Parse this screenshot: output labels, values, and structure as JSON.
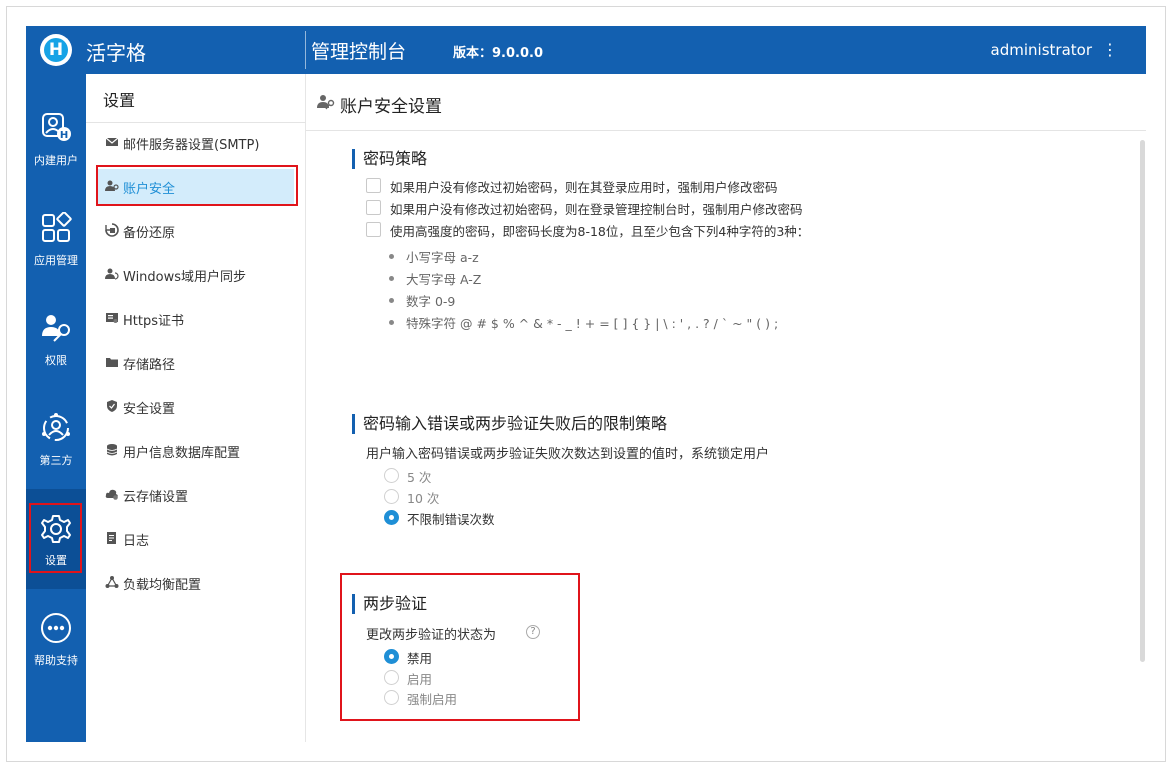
{
  "app": {
    "brand": "活字格",
    "console_title": "管理控制台",
    "version": "版本：9.0.0.0",
    "user": "administrator"
  },
  "rail": [
    {
      "label": "内建用户",
      "icon": "user-badge-icon"
    },
    {
      "label": "应用管理",
      "icon": "apps-grid-icon"
    },
    {
      "label": "权限",
      "icon": "user-key-icon"
    },
    {
      "label": "第三方",
      "icon": "third-party-icon"
    },
    {
      "label": "设置",
      "icon": "gear-icon"
    },
    {
      "label": "帮助支持",
      "icon": "more-dots-icon"
    }
  ],
  "nav": {
    "title": "设置",
    "items": [
      {
        "label": "邮件服务器设置(SMTP)",
        "icon": "mail-icon"
      },
      {
        "label": "账户安全",
        "icon": "user-key-icon"
      },
      {
        "label": "备份还原",
        "icon": "backup-icon"
      },
      {
        "label": "Windows域用户同步",
        "icon": "sync-users-icon"
      },
      {
        "label": "Https证书",
        "icon": "certificate-icon"
      },
      {
        "label": "存储路径",
        "icon": "folder-icon"
      },
      {
        "label": "安全设置",
        "icon": "shield-icon"
      },
      {
        "label": "用户信息数据库配置",
        "icon": "database-icon"
      },
      {
        "label": "云存储设置",
        "icon": "cloud-icon"
      },
      {
        "label": "日志",
        "icon": "log-icon"
      },
      {
        "label": "负载均衡配置",
        "icon": "load-balance-icon"
      }
    ]
  },
  "main": {
    "title": "账户安全设置",
    "password_policy": {
      "title": "密码策略",
      "options": [
        "如果用户没有修改过初始密码，则在其登录应用时，强制用户修改密码",
        "如果用户没有修改过初始密码，则在登录管理控制台时，强制用户修改密码",
        "使用高强度的密码，即密码长度为8-18位，且至少包含下列4种字符的3种："
      ],
      "rules": [
        "小写字母 a-z",
        "大写字母 A-Z",
        "数字 0-9",
        "特殊字符 @ # $ % ^ & * - _ ! + = [ ] { } | \\ :  ' , . ? / ` ~ \" ( ) ;"
      ]
    },
    "lockout": {
      "title": "密码输入错误或两步验证失败后的限制策略",
      "description": "用户输入密码错误或两步验证失败次数达到设置的值时，系统锁定用户",
      "options": [
        "5 次",
        "10 次",
        "不限制错误次数"
      ],
      "selected_index": 2
    },
    "two_factor": {
      "title": "两步验证",
      "description": "更改两步验证的状态为",
      "help": "?",
      "options": [
        "禁用",
        "启用",
        "强制启用"
      ],
      "selected_index": 0
    }
  },
  "colors": {
    "primary": "#1360b0",
    "accent": "#1f8fd6",
    "selected_bg": "#d3ecfb",
    "highlight": "#e0141b"
  }
}
